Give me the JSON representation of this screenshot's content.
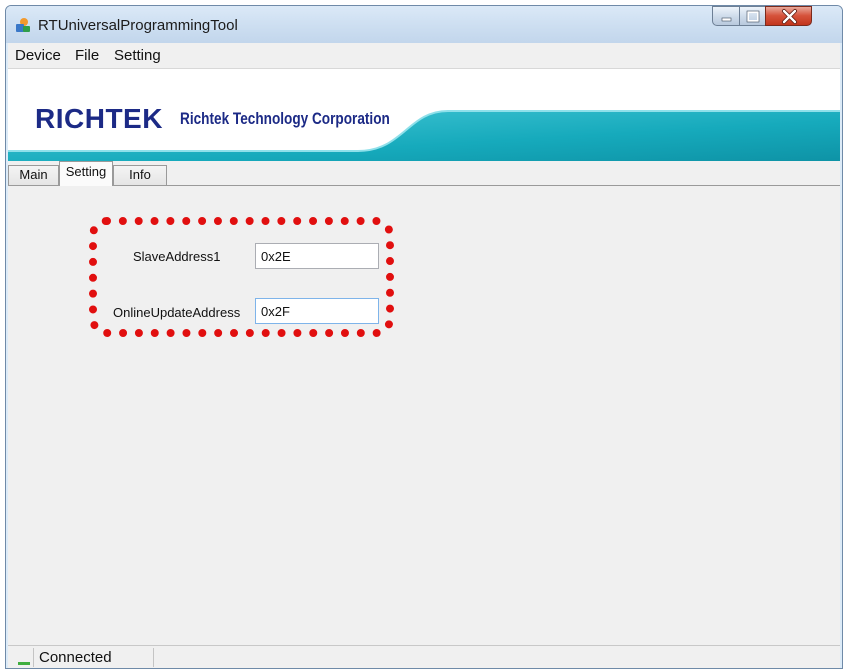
{
  "window": {
    "title": "RTUniversalProgrammingTool",
    "icon": "app-icon"
  },
  "menu": {
    "items": [
      "Device",
      "File",
      "Setting"
    ]
  },
  "banner": {
    "logo_word": "RICHTEK",
    "company_name": "Richtek Technology Corporation",
    "colors": {
      "logo": "#1c2a86",
      "swoosh": "#1db3c6"
    }
  },
  "tabs": {
    "items": [
      "Main",
      "Setting",
      "Info"
    ],
    "active": "Setting"
  },
  "settings": {
    "slave_address_label": "SlaveAddress1",
    "slave_address_value": "0x2E",
    "online_update_label": "OnlineUpdateAddress",
    "online_update_value": "0x2F",
    "highlight_color": "#e10f0f"
  },
  "status": {
    "text": "Connected",
    "indicator_color": "#3fae3f"
  }
}
